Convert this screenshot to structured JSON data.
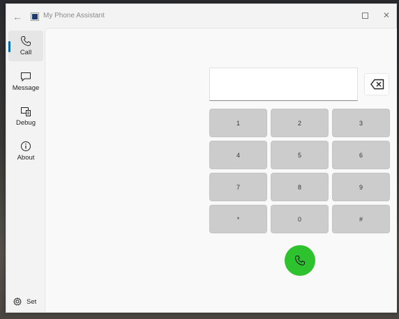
{
  "window": {
    "title": "My Phone Assistant"
  },
  "sidebar": {
    "items": [
      {
        "label": "Call",
        "icon": "phone-icon",
        "selected": true
      },
      {
        "label": "Message",
        "icon": "message-icon",
        "selected": false
      },
      {
        "label": "Debug",
        "icon": "debug-icon",
        "selected": false
      },
      {
        "label": "About",
        "icon": "info-icon",
        "selected": false
      }
    ],
    "settings_label": "Set"
  },
  "dialer": {
    "number_value": "",
    "keys": [
      "1",
      "2",
      "3",
      "4",
      "5",
      "6",
      "7",
      "8",
      "9",
      "*",
      "0",
      "#"
    ]
  },
  "colors": {
    "accent": "#0063b1",
    "call_button": "#2ec22e",
    "key_background": "#cccccc"
  }
}
